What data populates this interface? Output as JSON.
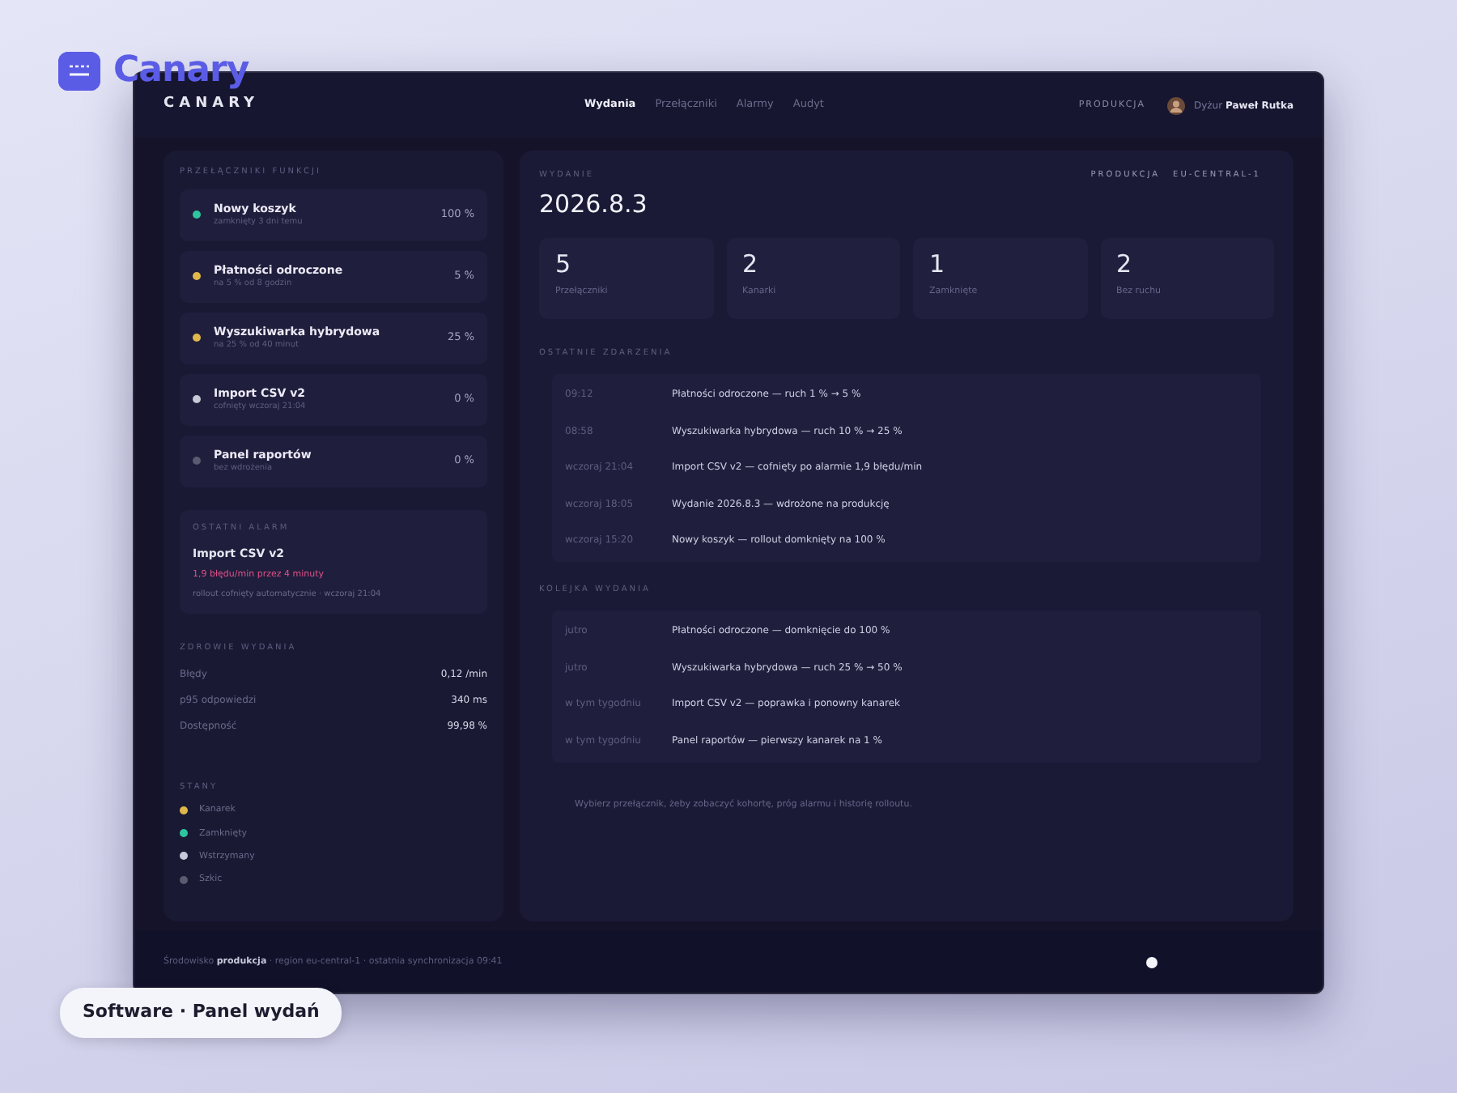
{
  "brand": {
    "name": "Canary"
  },
  "caption": "Software · Panel wydań",
  "app": {
    "logo": "CANARY",
    "nav": [
      {
        "label": "Wydania",
        "selected": true
      },
      {
        "label": "Przełączniki",
        "selected": false
      },
      {
        "label": "Alarmy",
        "selected": false
      },
      {
        "label": "Audyt",
        "selected": false
      }
    ],
    "env": "PRODUKCJA",
    "user": "Dyżur **Paweł Rutka**"
  },
  "sidebar": {
    "toggles_title": "PRZEŁĄCZNIKI FUNKCJI",
    "toggles": [
      {
        "name": "Nowy koszyk",
        "detail": "zamknięty 3 dni temu",
        "value": "100 %",
        "color": "#2ec4a0"
      },
      {
        "name": "Płatności odroczone",
        "detail": "na 5 % od 8 godzin",
        "value": "5 %",
        "color": "#e0b84a"
      },
      {
        "name": "Wyszukiwarka hybrydowa",
        "detail": "na 25 % od 40 minut",
        "value": "25 %",
        "color": "#e0b84a"
      },
      {
        "name": "Import CSV v2",
        "detail": "cofnięty wczoraj 21:04",
        "value": "0 %",
        "color": "#c8c8d8"
      },
      {
        "name": "Panel raportów",
        "detail": "bez wdrożenia",
        "value": "0 %",
        "color": "#5a5a70"
      }
    ],
    "alarm": {
      "title": "OSTATNI ALARM",
      "name": "Import CSV v2",
      "message": "1,9 błędu/min przez 4 minuty",
      "note": "rollout cofnięty automatycznie · wczoraj 21:04"
    },
    "health": {
      "title": "ZDROWIE WYDANIA",
      "rows": [
        {
          "label": "Błędy",
          "value": "0,12 /min"
        },
        {
          "label": "p95 odpowiedzi",
          "value": "340 ms"
        },
        {
          "label": "Dostępność",
          "value": "99,98 %"
        }
      ]
    },
    "legend": {
      "title": "STANY",
      "items": [
        {
          "label": "Kanarek",
          "color": "#e0b84a"
        },
        {
          "label": "Zamknięty",
          "color": "#2ec4a0"
        },
        {
          "label": "Wstrzymany",
          "color": "#c8c8d8"
        },
        {
          "label": "Szkic",
          "color": "#5a5a70"
        }
      ]
    }
  },
  "release": {
    "label": "WYDANIE",
    "version": "2026.8.3",
    "env": "PRODUKCJA",
    "region": "EU-CENTRAL-1",
    "stats": [
      {
        "value": "5",
        "label": "Przełączniki"
      },
      {
        "value": "2",
        "label": "Kanarki"
      },
      {
        "value": "1",
        "label": "Zamknięte"
      },
      {
        "value": "2",
        "label": "Bez ruchu"
      }
    ],
    "events_title": "OSTATNIE ZDARZENIA",
    "events": [
      {
        "time": "09:12",
        "text": "Płatności odroczone — ruch 1 % → 5 %"
      },
      {
        "time": "08:58",
        "text": "Wyszukiwarka hybrydowa — ruch 10 % → 25 %"
      },
      {
        "time": "wczoraj 21:04",
        "text": "Import CSV v2 — cofnięty po alarmie 1,9 błędu/min"
      },
      {
        "time": "wczoraj 18:05",
        "text": "Wydanie 2026.8.3 — wdrożone na produkcję"
      },
      {
        "time": "wczoraj 15:20",
        "text": "Nowy koszyk — rollout domknięty na 100 %"
      }
    ],
    "queue_title": "KOLEJKA WYDANIA",
    "queue": [
      {
        "time": "jutro",
        "text": "Płatności odroczone — domknięcie do 100 %"
      },
      {
        "time": "jutro",
        "text": "Wyszukiwarka hybrydowa — ruch 25 % → 50 %"
      },
      {
        "time": "w tym tygodniu",
        "text": "Import CSV v2 — poprawka i ponowny kanarek"
      },
      {
        "time": "w tym tygodniu",
        "text": "Panel raportów — pierwszy kanarek na 1 %"
      }
    ],
    "hint": "Wybierz przełącznik, żeby zobaczyć kohortę, próg alarmu i historię rolloutu."
  },
  "footer": {
    "status": "Środowisko **produkcja** · region eu-central-1 · ostatnia synchronizacja 09:41"
  }
}
